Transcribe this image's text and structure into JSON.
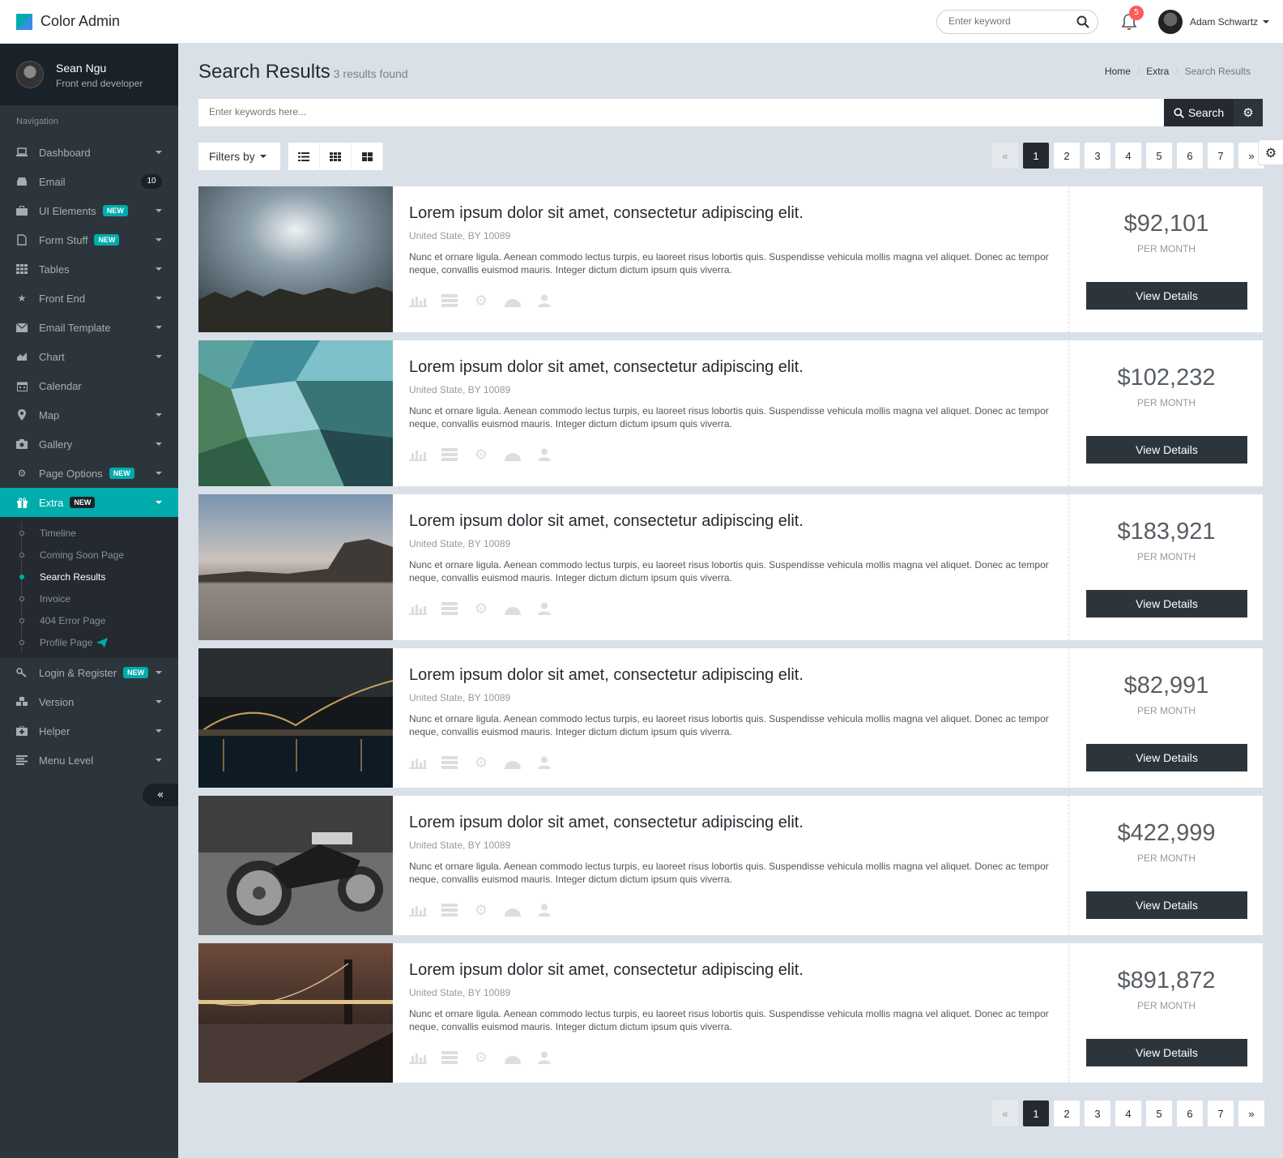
{
  "header": {
    "brand": "Color Admin",
    "search_placeholder": "Enter keyword",
    "notification_count": "5",
    "user_name": "Adam Schwartz"
  },
  "sidebar": {
    "profile_name": "Sean Ngu",
    "profile_role": "Front end developer",
    "nav_header": "Navigation",
    "items": [
      {
        "label": "Dashboard",
        "icon": "laptop-icon"
      },
      {
        "label": "Email",
        "icon": "inbox-icon",
        "badge": "10"
      },
      {
        "label": "UI Elements",
        "icon": "suitcase-icon",
        "new": "NEW"
      },
      {
        "label": "Form Stuff",
        "icon": "file-icon",
        "new": "NEW"
      },
      {
        "label": "Tables",
        "icon": "table-icon"
      },
      {
        "label": "Front End",
        "icon": "star-icon"
      },
      {
        "label": "Email Template",
        "icon": "envelope-icon"
      },
      {
        "label": "Chart",
        "icon": "area-chart-icon"
      },
      {
        "label": "Calendar",
        "icon": "calendar-icon"
      },
      {
        "label": "Map",
        "icon": "map-marker-icon"
      },
      {
        "label": "Gallery",
        "icon": "camera-icon"
      },
      {
        "label": "Page Options",
        "icon": "cogs-icon",
        "new": "NEW"
      },
      {
        "label": "Extra",
        "icon": "gift-icon",
        "new": "NEW"
      }
    ],
    "sub_items": [
      "Timeline",
      "Coming Soon Page",
      "Search Results",
      "Invoice",
      "404 Error Page",
      "Profile Page"
    ],
    "items_after": [
      {
        "label": "Login & Register",
        "icon": "key-icon",
        "new": "NEW"
      },
      {
        "label": "Version",
        "icon": "cubes-icon"
      },
      {
        "label": "Helper",
        "icon": "medkit-icon"
      },
      {
        "label": "Menu Level",
        "icon": "align-left-icon"
      }
    ],
    "collapse_symbol": "«"
  },
  "content": {
    "title": "Search Results",
    "subtitle": "3 results found",
    "breadcrumb": [
      "Home",
      "Extra",
      "Search Results"
    ],
    "search_placeholder": "Enter keywords here...",
    "search_button": "Search",
    "filters_label": "Filters by",
    "pages": [
      "«",
      "1",
      "2",
      "3",
      "4",
      "5",
      "6",
      "7",
      "»"
    ],
    "results": [
      {
        "title": "Lorem ipsum dolor sit amet, consectetur adipiscing elit.",
        "location": "United State, BY 10089",
        "desc": "Nunc et ornare ligula. Aenean commodo lectus turpis, eu laoreet risus lobortis quis. Suspendisse vehicula mollis magna vel aliquet. Donec ac tempor neque, convallis euismod mauris. Integer dictum dictum ipsum quis viverra.",
        "price": "$92,101",
        "per": "PER MONTH",
        "button": "View Details"
      },
      {
        "title": "Lorem ipsum dolor sit amet, consectetur adipiscing elit.",
        "location": "United State, BY 10089",
        "desc": "Nunc et ornare ligula. Aenean commodo lectus turpis, eu laoreet risus lobortis quis. Suspendisse vehicula mollis magna vel aliquet. Donec ac tempor neque, convallis euismod mauris. Integer dictum dictum ipsum quis viverra.",
        "price": "$102,232",
        "per": "PER MONTH",
        "button": "View Details"
      },
      {
        "title": "Lorem ipsum dolor sit amet, consectetur adipiscing elit.",
        "location": "United State, BY 10089",
        "desc": "Nunc et ornare ligula. Aenean commodo lectus turpis, eu laoreet risus lobortis quis. Suspendisse vehicula mollis magna vel aliquet. Donec ac tempor neque, convallis euismod mauris. Integer dictum dictum ipsum quis viverra.",
        "price": "$183,921",
        "per": "PER MONTH",
        "button": "View Details"
      },
      {
        "title": "Lorem ipsum dolor sit amet, consectetur adipiscing elit.",
        "location": "United State, BY 10089",
        "desc": "Nunc et ornare ligula. Aenean commodo lectus turpis, eu laoreet risus lobortis quis. Suspendisse vehicula mollis magna vel aliquet. Donec ac tempor neque, convallis euismod mauris. Integer dictum dictum ipsum quis viverra.",
        "price": "$82,991",
        "per": "PER MONTH",
        "button": "View Details"
      },
      {
        "title": "Lorem ipsum dolor sit amet, consectetur adipiscing elit.",
        "location": "United State, BY 10089",
        "desc": "Nunc et ornare ligula. Aenean commodo lectus turpis, eu laoreet risus lobortis quis. Suspendisse vehicula mollis magna vel aliquet. Donec ac tempor neque, convallis euismod mauris. Integer dictum dictum ipsum quis viverra.",
        "price": "$422,999",
        "per": "PER MONTH",
        "button": "View Details"
      },
      {
        "title": "Lorem ipsum dolor sit amet, consectetur adipiscing elit.",
        "location": "United State, BY 10089",
        "desc": "Nunc et ornare ligula. Aenean commodo lectus turpis, eu laoreet risus lobortis quis. Suspendisse vehicula mollis magna vel aliquet. Donec ac tempor neque, convallis euismod mauris. Integer dictum dictum ipsum quis viverra.",
        "price": "$891,872",
        "per": "PER MONTH",
        "button": "View Details"
      }
    ],
    "result_icons": [
      "bar-chart-icon",
      "server-icon",
      "cog-icon",
      "dashboard-icon",
      "user-icon"
    ]
  },
  "colors": {
    "accent": "#00acac",
    "dark": "#242a30",
    "sidebar": "#2d353c",
    "badge_red": "#ff5b57"
  }
}
